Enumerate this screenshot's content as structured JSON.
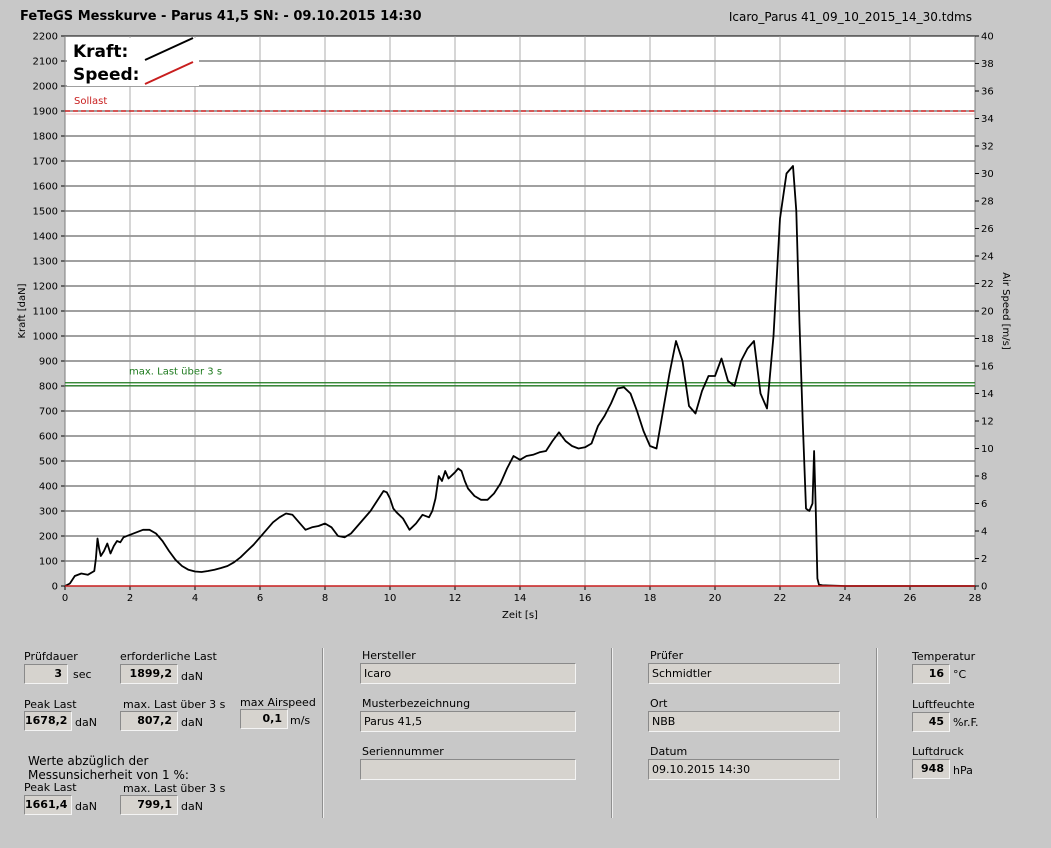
{
  "header": {
    "title": "FeTeGS Messkurve - Parus 41,5  SN:  - 09.10.2015 14:30",
    "filename": "Icaro_Parus 41_09_10_2015_14_30.tdms"
  },
  "colors": {
    "kraft": "#000000",
    "speed": "#c81e1e",
    "sollast": "#c81e1e",
    "maxlast": "#1e7a1e",
    "plot_bg": "#ffffff",
    "page_bg": "#c8c8c8"
  },
  "chart_data": {
    "type": "line",
    "xlabel": "Zeit [s]",
    "ylabel": "Kraft [daN]",
    "y2label": "Air Speed [m/s]",
    "xlim": [
      0,
      28
    ],
    "ylim": [
      0,
      2200
    ],
    "y2lim": [
      0,
      40
    ],
    "x_ticks": [
      0,
      2,
      4,
      6,
      8,
      10,
      12,
      14,
      16,
      18,
      20,
      22,
      24,
      26,
      28
    ],
    "y_ticks": [
      0,
      100,
      200,
      300,
      400,
      500,
      600,
      700,
      800,
      900,
      1000,
      1100,
      1200,
      1300,
      1400,
      1500,
      1600,
      1700,
      1800,
      1900,
      2000,
      2100,
      2200
    ],
    "y2_ticks": [
      0,
      2,
      4,
      6,
      8,
      10,
      12,
      14,
      16,
      18,
      20,
      22,
      24,
      26,
      28,
      30,
      32,
      34,
      36,
      38,
      40
    ],
    "grid": true,
    "legend": [
      {
        "name": "Kraft:",
        "color": "#000000"
      },
      {
        "name": "Speed:",
        "color": "#c81e1e"
      }
    ],
    "reference_lines": [
      {
        "name": "Sollast",
        "y": 1900,
        "color": "#c81e1e"
      },
      {
        "name": "max. Last über  3 s",
        "y": 807,
        "color": "#1e7a1e"
      }
    ],
    "series": [
      {
        "name": "Kraft:",
        "axis": "left",
        "x": [
          0,
          0.15,
          0.3,
          0.5,
          0.7,
          0.9,
          0.95,
          1.0,
          1.05,
          1.1,
          1.2,
          1.3,
          1.4,
          1.5,
          1.6,
          1.7,
          1.8,
          2.0,
          2.2,
          2.4,
          2.6,
          2.8,
          3.0,
          3.2,
          3.4,
          3.6,
          3.8,
          4.0,
          4.2,
          4.4,
          4.6,
          4.8,
          5.0,
          5.2,
          5.4,
          5.6,
          5.8,
          6.0,
          6.2,
          6.4,
          6.6,
          6.8,
          7.0,
          7.2,
          7.4,
          7.6,
          7.8,
          8.0,
          8.2,
          8.4,
          8.6,
          8.8,
          9.0,
          9.2,
          9.4,
          9.6,
          9.8,
          9.9,
          10.0,
          10.1,
          10.2,
          10.4,
          10.6,
          10.8,
          11.0,
          11.2,
          11.3,
          11.4,
          11.5,
          11.6,
          11.7,
          11.8,
          12.0,
          12.1,
          12.2,
          12.3,
          12.4,
          12.6,
          12.8,
          13.0,
          13.2,
          13.4,
          13.6,
          13.8,
          14.0,
          14.2,
          14.4,
          14.6,
          14.8,
          15.0,
          15.2,
          15.4,
          15.6,
          15.8,
          16.0,
          16.2,
          16.4,
          16.6,
          16.8,
          17.0,
          17.2,
          17.4,
          17.6,
          17.8,
          18.0,
          18.2,
          18.4,
          18.6,
          18.8,
          19.0,
          19.2,
          19.4,
          19.6,
          19.8,
          20.0,
          20.2,
          20.4,
          20.6,
          20.8,
          21.0,
          21.2,
          21.4,
          21.6,
          21.8,
          22.0,
          22.2,
          22.4,
          22.5,
          22.6,
          22.7,
          22.8,
          22.9,
          23.0,
          23.05,
          23.1,
          23.15,
          23.2,
          23.3,
          23.5,
          24,
          26,
          28
        ],
        "values": [
          0,
          10,
          40,
          50,
          45,
          60,
          110,
          190,
          150,
          120,
          140,
          170,
          130,
          160,
          180,
          175,
          195,
          205,
          215,
          225,
          225,
          210,
          180,
          140,
          105,
          80,
          65,
          58,
          56,
          60,
          65,
          72,
          80,
          95,
          115,
          140,
          165,
          195,
          225,
          255,
          275,
          290,
          285,
          255,
          225,
          235,
          240,
          250,
          235,
          200,
          195,
          210,
          240,
          270,
          300,
          340,
          380,
          375,
          350,
          310,
          295,
          270,
          225,
          250,
          285,
          275,
          300,
          350,
          440,
          420,
          460,
          430,
          455,
          470,
          460,
          420,
          390,
          360,
          345,
          345,
          370,
          410,
          470,
          520,
          505,
          520,
          525,
          535,
          540,
          580,
          615,
          580,
          560,
          550,
          555,
          570,
          640,
          680,
          730,
          790,
          795,
          770,
          700,
          620,
          560,
          550,
          700,
          850,
          980,
          900,
          720,
          690,
          780,
          840,
          840,
          910,
          820,
          800,
          900,
          950,
          980,
          770,
          710,
          1000,
          1470,
          1650,
          1680,
          1500,
          1050,
          650,
          310,
          300,
          330,
          540,
          300,
          30,
          5,
          3,
          2,
          0,
          0,
          0
        ]
      },
      {
        "name": "Speed:",
        "axis": "right",
        "x": [
          0,
          28
        ],
        "values": [
          0,
          0
        ]
      }
    ]
  },
  "info": {
    "pruefdauer_label": "Prüfdauer",
    "pruefdauer_value": "3",
    "pruefdauer_unit": "sec",
    "erf_last_label": "erforderliche Last",
    "erf_last_value": "1899,2",
    "erf_last_unit": "daN",
    "peak_last_label": "Peak Last",
    "peak_last_value": "1678,2",
    "peak_last_unit": "daN",
    "max_last_label": "max. Last über  3 s",
    "max_last_value": "807,2",
    "max_last_unit": "daN",
    "max_airspeed_label": "max Airspeed",
    "max_airspeed_value": "0,1",
    "max_airspeed_unit": "m/s",
    "werte_label_1": "Werte abzüglich der",
    "werte_label_2": "Messunsicherheit von 1  %:",
    "peak_last2_label": "Peak Last",
    "peak_last2_value": "1661,4",
    "peak_last2_unit": "daN",
    "max_last2_label": "max. Last über  3 s",
    "max_last2_value": "799,1",
    "max_last2_unit": "daN",
    "hersteller_label": "Hersteller",
    "hersteller_value": "Icaro",
    "muster_label": "Musterbezeichnung",
    "muster_value": "Parus 41,5",
    "serien_label": "Seriennummer",
    "serien_value": "",
    "pruefer_label": "Prüfer",
    "pruefer_value": "Schmidtler",
    "ort_label": "Ort",
    "ort_value": "NBB",
    "datum_label": "Datum",
    "datum_value": "09.10.2015 14:30",
    "temp_label": "Temperatur",
    "temp_value": "16",
    "temp_unit": "°C",
    "feuchte_label": "Luftfeuchte",
    "feuchte_value": "45",
    "feuchte_unit": "%r.F.",
    "druck_label": "Luftdruck",
    "druck_value": "948",
    "druck_unit": "hPa"
  }
}
